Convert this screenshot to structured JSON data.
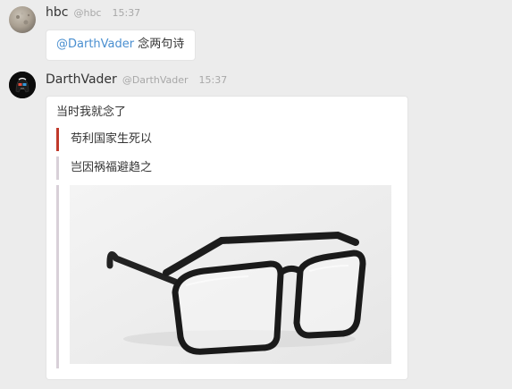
{
  "messages": [
    {
      "user": "hbc",
      "handle": "@hbc",
      "time": "15:37",
      "mention": "@DarthVader",
      "text": "念两句诗"
    },
    {
      "user": "DarthVader",
      "handle": "@DarthVader",
      "time": "15:37",
      "text": "当时我就念了",
      "quotes": [
        "苟利国家生死以",
        "岂因祸福避趋之"
      ],
      "image": {
        "alt": "glasses"
      }
    }
  ],
  "colors": {
    "background": "#ececec",
    "bubble": "#ffffff",
    "mention": "#4a8fd0",
    "quote_bar_primary": "#c0392b",
    "quote_bar_secondary": "#d8d0d8"
  }
}
